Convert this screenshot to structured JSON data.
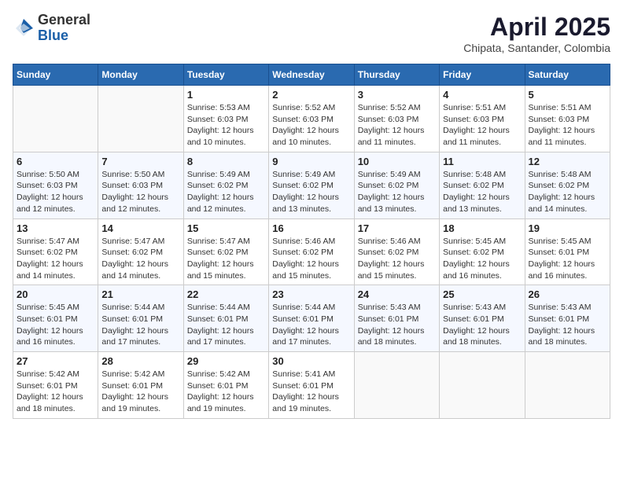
{
  "logo": {
    "general": "General",
    "blue": "Blue"
  },
  "title": {
    "month_year": "April 2025",
    "location": "Chipata, Santander, Colombia"
  },
  "days_of_week": [
    "Sunday",
    "Monday",
    "Tuesday",
    "Wednesday",
    "Thursday",
    "Friday",
    "Saturday"
  ],
  "weeks": [
    [
      {
        "day": "",
        "sunrise": "",
        "sunset": "",
        "daylight": ""
      },
      {
        "day": "",
        "sunrise": "",
        "sunset": "",
        "daylight": ""
      },
      {
        "day": "1",
        "sunrise": "Sunrise: 5:53 AM",
        "sunset": "Sunset: 6:03 PM",
        "daylight": "Daylight: 12 hours and 10 minutes."
      },
      {
        "day": "2",
        "sunrise": "Sunrise: 5:52 AM",
        "sunset": "Sunset: 6:03 PM",
        "daylight": "Daylight: 12 hours and 10 minutes."
      },
      {
        "day": "3",
        "sunrise": "Sunrise: 5:52 AM",
        "sunset": "Sunset: 6:03 PM",
        "daylight": "Daylight: 12 hours and 11 minutes."
      },
      {
        "day": "4",
        "sunrise": "Sunrise: 5:51 AM",
        "sunset": "Sunset: 6:03 PM",
        "daylight": "Daylight: 12 hours and 11 minutes."
      },
      {
        "day": "5",
        "sunrise": "Sunrise: 5:51 AM",
        "sunset": "Sunset: 6:03 PM",
        "daylight": "Daylight: 12 hours and 11 minutes."
      }
    ],
    [
      {
        "day": "6",
        "sunrise": "Sunrise: 5:50 AM",
        "sunset": "Sunset: 6:03 PM",
        "daylight": "Daylight: 12 hours and 12 minutes."
      },
      {
        "day": "7",
        "sunrise": "Sunrise: 5:50 AM",
        "sunset": "Sunset: 6:03 PM",
        "daylight": "Daylight: 12 hours and 12 minutes."
      },
      {
        "day": "8",
        "sunrise": "Sunrise: 5:49 AM",
        "sunset": "Sunset: 6:02 PM",
        "daylight": "Daylight: 12 hours and 12 minutes."
      },
      {
        "day": "9",
        "sunrise": "Sunrise: 5:49 AM",
        "sunset": "Sunset: 6:02 PM",
        "daylight": "Daylight: 12 hours and 13 minutes."
      },
      {
        "day": "10",
        "sunrise": "Sunrise: 5:49 AM",
        "sunset": "Sunset: 6:02 PM",
        "daylight": "Daylight: 12 hours and 13 minutes."
      },
      {
        "day": "11",
        "sunrise": "Sunrise: 5:48 AM",
        "sunset": "Sunset: 6:02 PM",
        "daylight": "Daylight: 12 hours and 13 minutes."
      },
      {
        "day": "12",
        "sunrise": "Sunrise: 5:48 AM",
        "sunset": "Sunset: 6:02 PM",
        "daylight": "Daylight: 12 hours and 14 minutes."
      }
    ],
    [
      {
        "day": "13",
        "sunrise": "Sunrise: 5:47 AM",
        "sunset": "Sunset: 6:02 PM",
        "daylight": "Daylight: 12 hours and 14 minutes."
      },
      {
        "day": "14",
        "sunrise": "Sunrise: 5:47 AM",
        "sunset": "Sunset: 6:02 PM",
        "daylight": "Daylight: 12 hours and 14 minutes."
      },
      {
        "day": "15",
        "sunrise": "Sunrise: 5:47 AM",
        "sunset": "Sunset: 6:02 PM",
        "daylight": "Daylight: 12 hours and 15 minutes."
      },
      {
        "day": "16",
        "sunrise": "Sunrise: 5:46 AM",
        "sunset": "Sunset: 6:02 PM",
        "daylight": "Daylight: 12 hours and 15 minutes."
      },
      {
        "day": "17",
        "sunrise": "Sunrise: 5:46 AM",
        "sunset": "Sunset: 6:02 PM",
        "daylight": "Daylight: 12 hours and 15 minutes."
      },
      {
        "day": "18",
        "sunrise": "Sunrise: 5:45 AM",
        "sunset": "Sunset: 6:02 PM",
        "daylight": "Daylight: 12 hours and 16 minutes."
      },
      {
        "day": "19",
        "sunrise": "Sunrise: 5:45 AM",
        "sunset": "Sunset: 6:01 PM",
        "daylight": "Daylight: 12 hours and 16 minutes."
      }
    ],
    [
      {
        "day": "20",
        "sunrise": "Sunrise: 5:45 AM",
        "sunset": "Sunset: 6:01 PM",
        "daylight": "Daylight: 12 hours and 16 minutes."
      },
      {
        "day": "21",
        "sunrise": "Sunrise: 5:44 AM",
        "sunset": "Sunset: 6:01 PM",
        "daylight": "Daylight: 12 hours and 17 minutes."
      },
      {
        "day": "22",
        "sunrise": "Sunrise: 5:44 AM",
        "sunset": "Sunset: 6:01 PM",
        "daylight": "Daylight: 12 hours and 17 minutes."
      },
      {
        "day": "23",
        "sunrise": "Sunrise: 5:44 AM",
        "sunset": "Sunset: 6:01 PM",
        "daylight": "Daylight: 12 hours and 17 minutes."
      },
      {
        "day": "24",
        "sunrise": "Sunrise: 5:43 AM",
        "sunset": "Sunset: 6:01 PM",
        "daylight": "Daylight: 12 hours and 18 minutes."
      },
      {
        "day": "25",
        "sunrise": "Sunrise: 5:43 AM",
        "sunset": "Sunset: 6:01 PM",
        "daylight": "Daylight: 12 hours and 18 minutes."
      },
      {
        "day": "26",
        "sunrise": "Sunrise: 5:43 AM",
        "sunset": "Sunset: 6:01 PM",
        "daylight": "Daylight: 12 hours and 18 minutes."
      }
    ],
    [
      {
        "day": "27",
        "sunrise": "Sunrise: 5:42 AM",
        "sunset": "Sunset: 6:01 PM",
        "daylight": "Daylight: 12 hours and 18 minutes."
      },
      {
        "day": "28",
        "sunrise": "Sunrise: 5:42 AM",
        "sunset": "Sunset: 6:01 PM",
        "daylight": "Daylight: 12 hours and 19 minutes."
      },
      {
        "day": "29",
        "sunrise": "Sunrise: 5:42 AM",
        "sunset": "Sunset: 6:01 PM",
        "daylight": "Daylight: 12 hours and 19 minutes."
      },
      {
        "day": "30",
        "sunrise": "Sunrise: 5:41 AM",
        "sunset": "Sunset: 6:01 PM",
        "daylight": "Daylight: 12 hours and 19 minutes."
      },
      {
        "day": "",
        "sunrise": "",
        "sunset": "",
        "daylight": ""
      },
      {
        "day": "",
        "sunrise": "",
        "sunset": "",
        "daylight": ""
      },
      {
        "day": "",
        "sunrise": "",
        "sunset": "",
        "daylight": ""
      }
    ]
  ]
}
